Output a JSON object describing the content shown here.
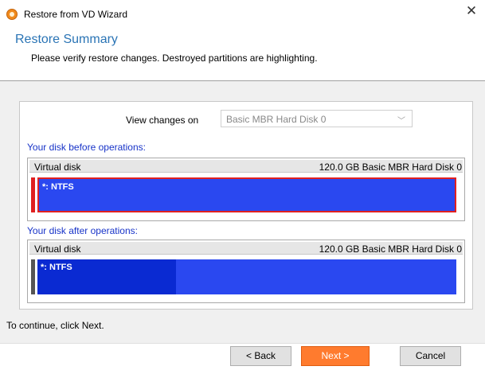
{
  "window": {
    "title": "Restore from VD Wizard",
    "close_glyph": "✕",
    "icon": "app-logo-icon"
  },
  "header": {
    "title": "Restore Summary",
    "subtitle": "Please verify restore changes. Destroyed partitions are highlighting."
  },
  "view": {
    "label": "View changes on",
    "selected": "Basic MBR Hard Disk 0",
    "arrow_glyph": "﹀"
  },
  "before": {
    "label": "Your disk before operations:",
    "disk_name": "Virtual disk",
    "disk_info": "120.0 GB  Basic MBR Hard Disk 0",
    "partition_label": "*: NTFS",
    "partition_state": "destroyed"
  },
  "after": {
    "label": "Your disk after operations:",
    "disk_name": "Virtual disk",
    "disk_info": "120.0 GB  Basic MBR Hard Disk 0",
    "partition_label": "*: NTFS",
    "used_fraction": 0.33
  },
  "colors": {
    "accent": "#2a74b5",
    "section_label": "#1733c8",
    "partition": "#2a48f0",
    "partition_used": "#0a2ad2",
    "destroyed_border": "#e02020",
    "next_button": "#ff7b2e"
  },
  "footer": {
    "instruction": "To continue, click Next.",
    "back_label": "< Back",
    "next_label": "Next >",
    "cancel_label": "Cancel"
  }
}
